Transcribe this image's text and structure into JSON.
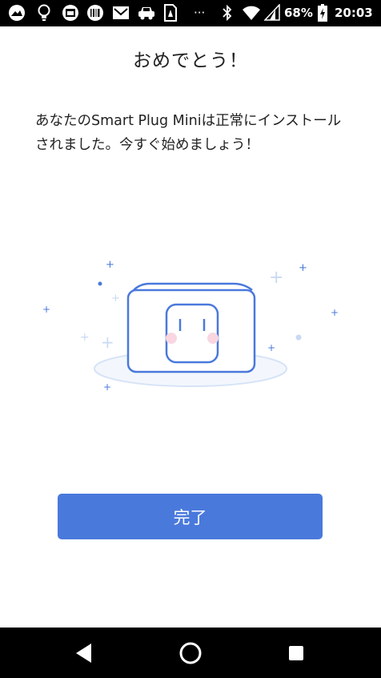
{
  "status_bar": {
    "battery_percent": "68%",
    "time": "20:03",
    "overflow": "···",
    "icons": [
      "navigation-app-icon",
      "lightbulb-icon",
      "calendar-icon",
      "barcode-icon",
      "mail-icon",
      "car-icon",
      "sim-card-icon",
      "overflow-dots",
      "bluetooth-icon",
      "wifi-icon",
      "cellular-signal-icon",
      "battery-charging-icon"
    ]
  },
  "main": {
    "title": "おめでとう！",
    "message": "あなたのSmart Plug Miniは正常にインストールされました。今すぐ始めましょう！",
    "illustration": "smart-plug-illustration",
    "accent_color": "#4a79dc"
  },
  "actions": {
    "done_label": "完了"
  },
  "nav_bar": {
    "icons": [
      "back-icon",
      "home-icon",
      "recents-icon"
    ]
  }
}
